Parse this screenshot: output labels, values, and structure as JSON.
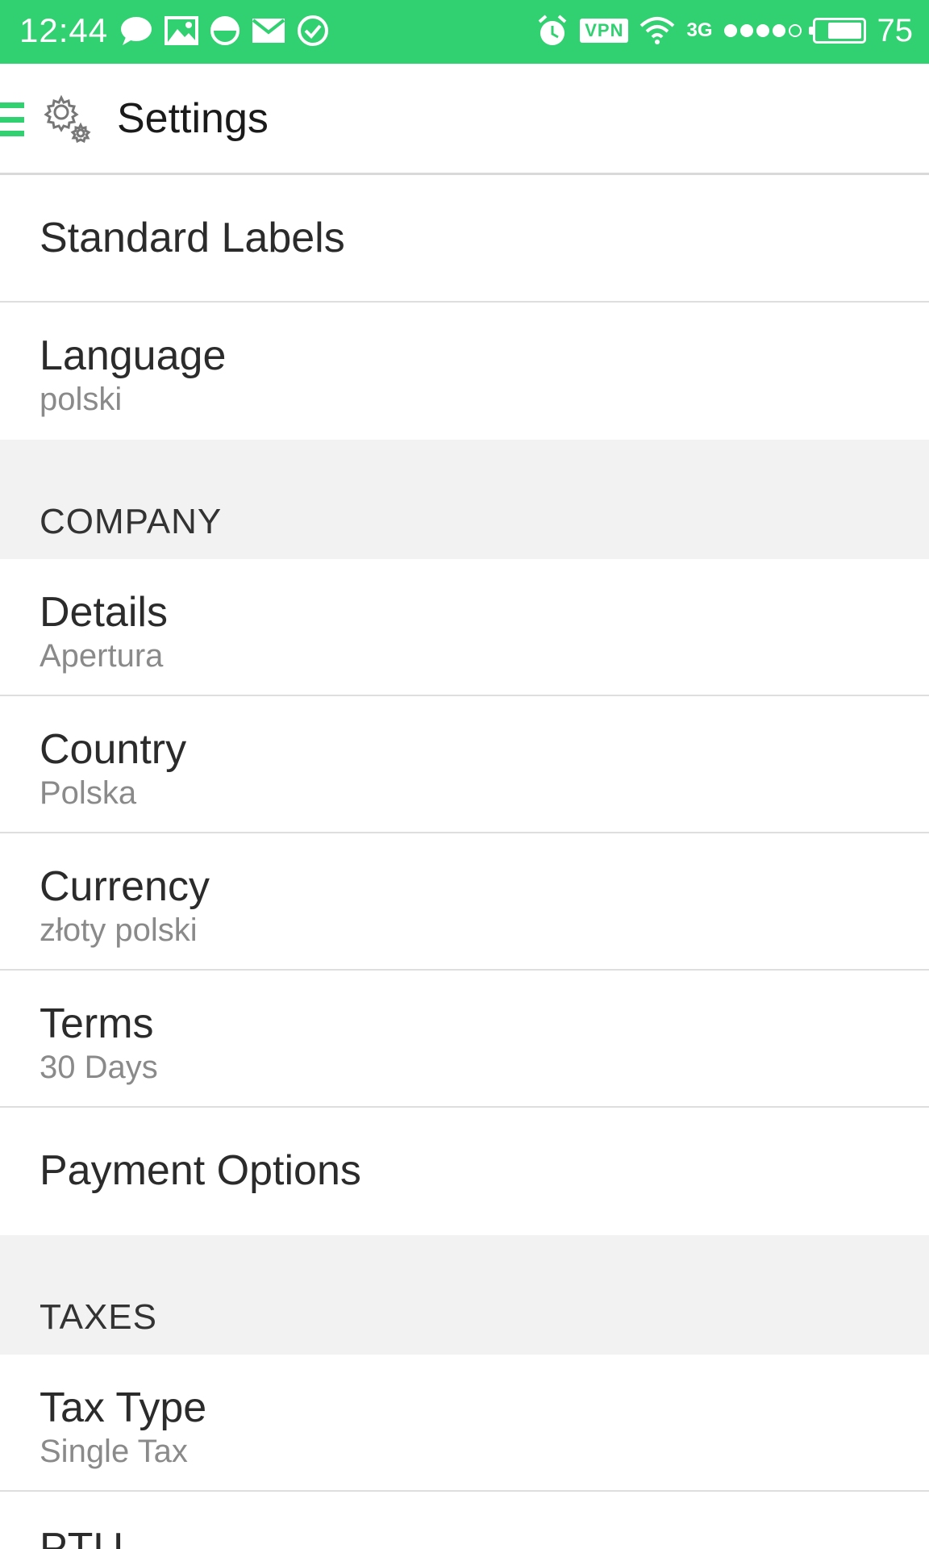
{
  "status_bar": {
    "time": "12:44",
    "left_icons": [
      "chat-bubble-icon",
      "image-icon",
      "half-circle-icon",
      "mail-icon",
      "check-circle-icon"
    ],
    "vpn_label": "VPN",
    "network_label": "3G",
    "signal_strength": {
      "filled": 4,
      "total": 5
    },
    "battery_level": 0.75,
    "battery_percent": "75",
    "background_color": "#31d070"
  },
  "app_bar": {
    "title": "Settings",
    "menu_icon": "hamburger-menu-icon",
    "title_icon": "gears-icon",
    "accent_color": "#31d070"
  },
  "settings": {
    "standard_labels": {
      "title": "Standard Labels"
    },
    "language": {
      "title": "Language",
      "value": "polski"
    },
    "company_header": "COMPANY",
    "details": {
      "title": "Details",
      "value": "Apertura"
    },
    "country": {
      "title": "Country",
      "value": "Polska"
    },
    "currency": {
      "title": "Currency",
      "value": "złoty polski"
    },
    "terms": {
      "title": "Terms",
      "value": "30 Days"
    },
    "payment_options": {
      "title": "Payment Options"
    },
    "taxes_header": "TAXES",
    "tax_type": {
      "title": "Tax Type",
      "value": "Single Tax"
    },
    "partial_item": {
      "title": "PTU"
    }
  }
}
